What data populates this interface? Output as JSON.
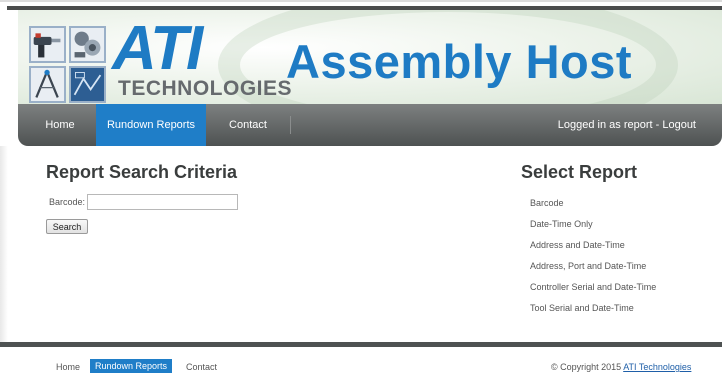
{
  "header": {
    "brand_main": "ATI",
    "brand_sub": "TECHNOLOGIES",
    "app_title": "Assembly Host"
  },
  "nav": {
    "items": [
      {
        "label": "Home"
      },
      {
        "label": "Rundown Reports",
        "active": true
      },
      {
        "label": "Contact"
      }
    ],
    "login_text": "Logged in as report - Logout"
  },
  "search": {
    "title": "Report Search Criteria",
    "barcode_label": "Barcode:",
    "barcode_value": "",
    "button_label": "Search"
  },
  "reports": {
    "title": "Select Report",
    "items": [
      "Barcode",
      "Date-Time Only",
      "Address and Date-Time",
      "Address, Port and Date-Time",
      "Controller Serial and Date-Time",
      "Tool Serial and Date-Time"
    ]
  },
  "footer": {
    "links": [
      "Home",
      "Rundown Reports",
      "Contact"
    ],
    "copyright_prefix": "© Copyright 2015",
    "copyright_link": "ATI Technologies"
  },
  "colors": {
    "accent": "#1f7ec8",
    "brand_blue": "#1e7bc4",
    "nav_dark": "#4e5252"
  }
}
